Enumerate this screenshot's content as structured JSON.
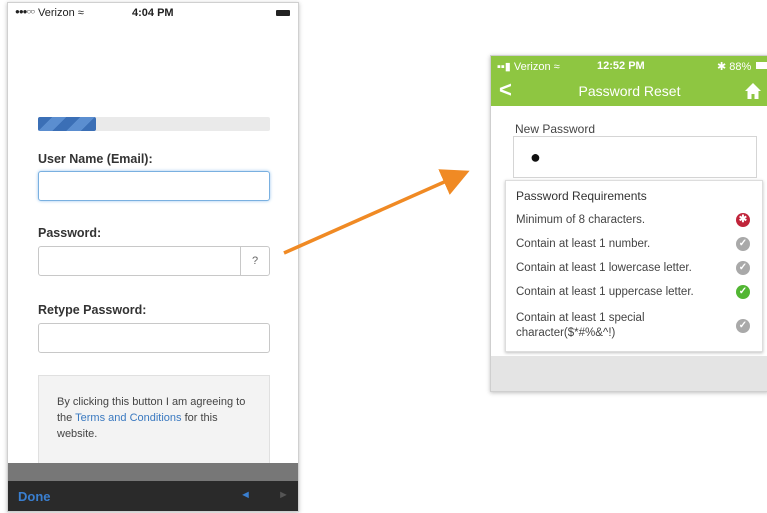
{
  "left_screen": {
    "status_bar": {
      "signal": "●●●○○",
      "carrier": "Verizon ≈",
      "time": "4:04 PM"
    },
    "progress_fraction": 0.25,
    "username_label": "User Name (Email):",
    "password_label": "Password:",
    "password_help": "?",
    "retype_label": "Retype Password:",
    "terms_prefix": "By clicking this button I am agreeing to the ",
    "terms_link": "Terms and Conditions",
    "terms_suffix": " for this website.",
    "keyboard_toolbar": {
      "done": "Done",
      "prev": "◄",
      "next": "►"
    }
  },
  "right_screen": {
    "status_bar": {
      "carrier": "▪▪▮ Verizon ≈",
      "time": "12:52 PM",
      "battery": "✱ 88%"
    },
    "nav": {
      "back": "<",
      "title": "Password Reset"
    },
    "new_password_label": "New Password",
    "new_password_value": "●",
    "requirements_title": "Password Requirements",
    "requirements": [
      {
        "text": "Minimum of 8 characters.",
        "status": "failed",
        "glyph": "✱"
      },
      {
        "text": "Contain at least 1 number.",
        "status": "pending",
        "glyph": "✓"
      },
      {
        "text": "Contain at least 1 lowercase letter.",
        "status": "pending",
        "glyph": "✓"
      },
      {
        "text": "Contain at least 1 uppercase letter.",
        "status": "met",
        "glyph": "✓"
      },
      {
        "text": "Contain at least 1 special character($*#%&^!)",
        "status": "pending",
        "glyph": "✓"
      }
    ]
  },
  "colors": {
    "accent_green": "#8ec641",
    "link_blue": "#3a79c0",
    "arrow_orange": "#f08a24",
    "status_failed": "#c0243a",
    "status_pending": "#a9a9a9",
    "status_met": "#52b633"
  },
  "icons": [
    "back-chevron-icon",
    "home-icon",
    "wifi-icon",
    "battery-icon",
    "check-circle-icon",
    "asterisk-circle-icon"
  ]
}
